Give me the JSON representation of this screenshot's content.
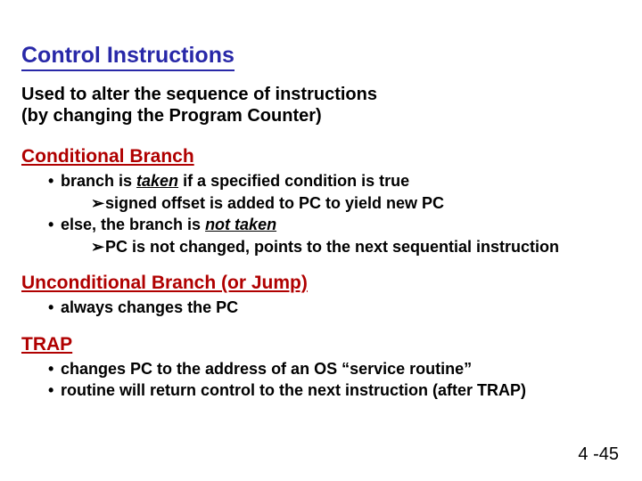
{
  "title": "Control Instructions",
  "intro_l1": "Used to alter the sequence of instructions",
  "intro_l2": "(by changing the Program Counter)",
  "sec1": {
    "heading": "Conditional Branch",
    "b1a_pre": "branch is ",
    "b1a_em": "taken",
    "b1a_post": " if a specified condition is true",
    "b2a": "signed offset is added to PC to yield new PC",
    "b1b_pre": "else, the branch is ",
    "b1b_em": "not taken",
    "b2b": "PC is not changed, points to the next sequential instruction"
  },
  "sec2": {
    "heading": "Unconditional Branch (or Jump)",
    "b1": "always changes the PC"
  },
  "sec3": {
    "heading": "TRAP",
    "b1": "changes PC to the address of an OS “service routine”",
    "b2": "routine will return control to the next instruction (after TRAP)"
  },
  "page": "4 -45",
  "glyph": {
    "bullet": "•",
    "arrow": "➢"
  }
}
